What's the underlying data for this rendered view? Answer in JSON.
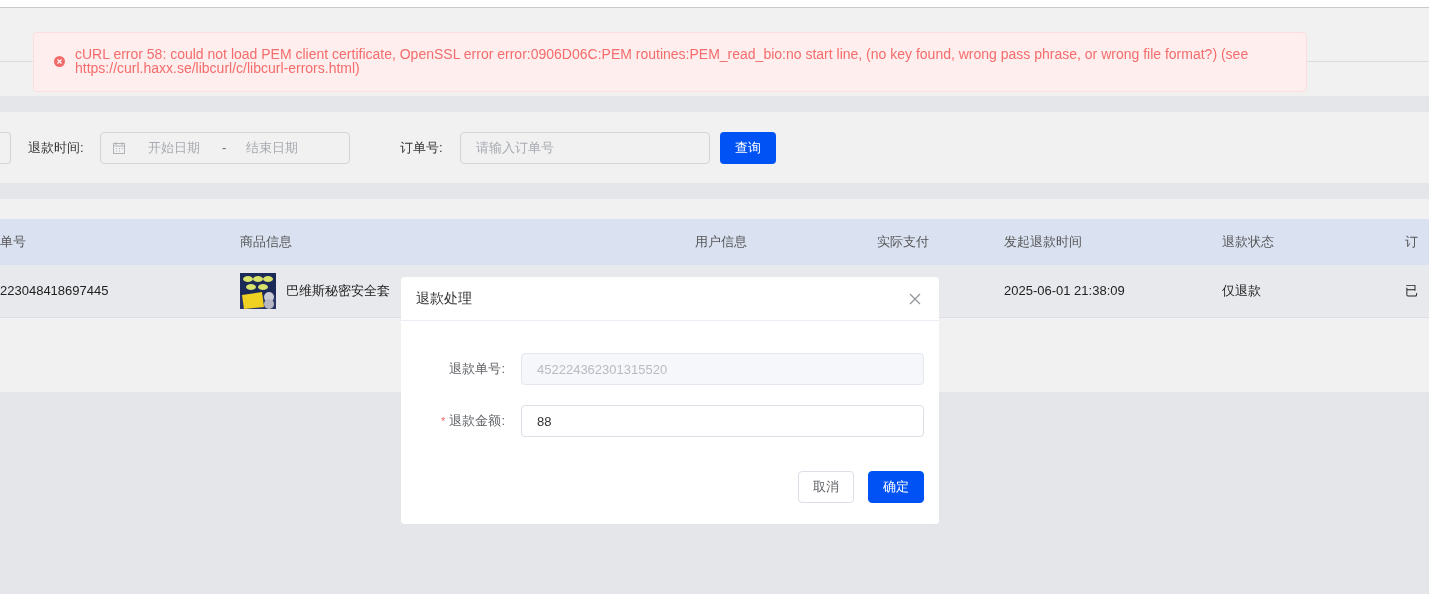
{
  "alert": {
    "message": "cURL error 58: could not load PEM client certificate, OpenSSL error error:0906D06C:PEM routines:PEM_read_bio:no start line, (no key found, wrong pass phrase, or wrong file format?) (see https://curl.haxx.se/libcurl/c/libcurl-errors.html)"
  },
  "filters": {
    "refund_time": {
      "label": "退款时间:",
      "start_placeholder": "开始日期",
      "separator": "-",
      "end_placeholder": "结束日期"
    },
    "order_no": {
      "label": "订单号:",
      "placeholder": "请输入订单号"
    },
    "search_button": "查询"
  },
  "table": {
    "columns": [
      "单号",
      "商品信息",
      "用户信息",
      "实际支付",
      "发起退款时间",
      "退款状态",
      "订"
    ],
    "rows": [
      {
        "order_no": "223048418697445",
        "product": {
          "kind": "picture",
          "name": "巴维斯秘密安全套"
        },
        "refund_time": "2025-06-01 21:38:09",
        "refund_status": "仅退款",
        "order_status": "已"
      }
    ]
  },
  "dialog": {
    "title": "退款处理",
    "fields": [
      {
        "label": "退款单号:",
        "value": "452224362301315520",
        "required": false,
        "disabled": true
      },
      {
        "label": "退款金额:",
        "value": "88",
        "required": true,
        "required_mark": "*",
        "disabled": false
      }
    ],
    "buttons": [
      {
        "label": "取消",
        "kind": "secondary"
      },
      {
        "label": "确定",
        "kind": "primary"
      }
    ]
  }
}
